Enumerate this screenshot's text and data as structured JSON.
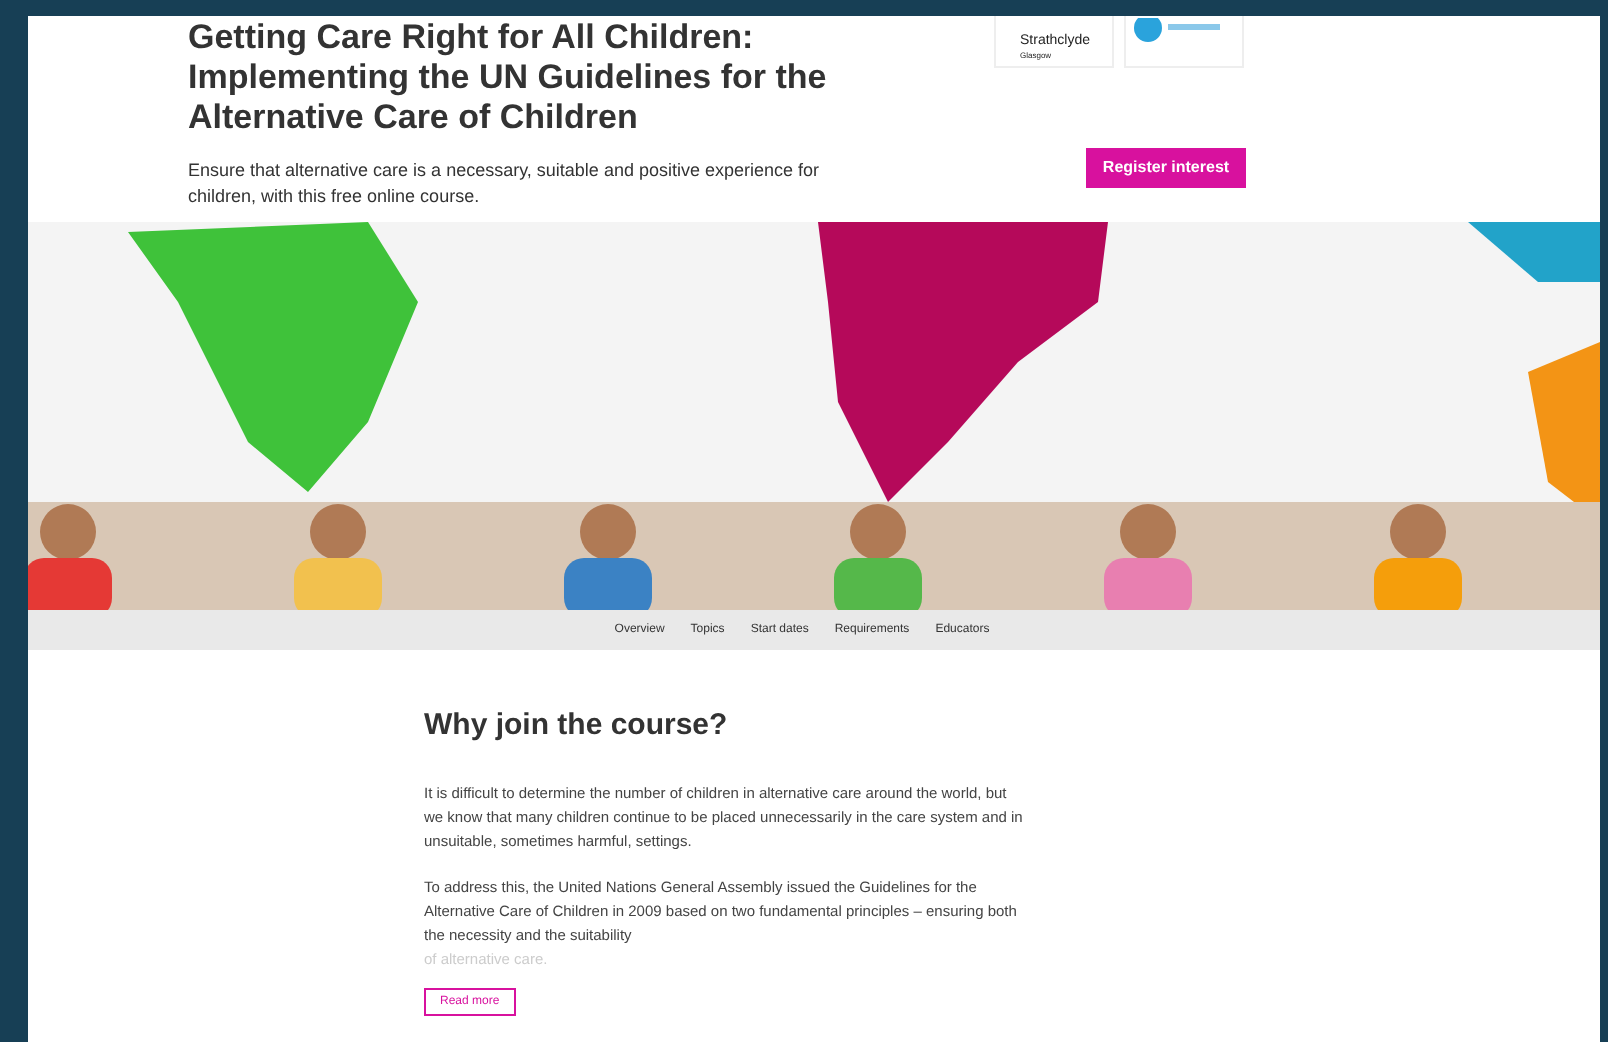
{
  "header": {
    "title": "Getting Care Right for All Children: Implementing the UN Guidelines for the Alternative Care of Children",
    "description": "Ensure that alternative care is a necessary, suitable and positive experience for children, with this free online course.",
    "logos": [
      {
        "kind": "text",
        "lines": [
          "Strathclyde",
          "Glasgow"
        ]
      },
      {
        "kind": "badge"
      }
    ],
    "register_button": "Register interest"
  },
  "nav": [
    {
      "label": "Overview"
    },
    {
      "label": "Topics"
    },
    {
      "label": "Start dates"
    },
    {
      "label": "Requirements"
    },
    {
      "label": "Educators"
    }
  ],
  "section": {
    "heading": "Why join the course?",
    "paragraphs": [
      {
        "text": "It is difficult to determine the number of children in alternative care around the world, but we know that many children continue to be placed unnecessarily in the care system and in unsuitable, sometimes harmful, settings.",
        "faded": false
      },
      {
        "text": "To address this, the United Nations General Assembly issued the Guidelines for the Alternative Care of Children in 2009 based on two fundamental principles – ensuring both the necessity and the suitability",
        "faded": false
      },
      {
        "text": "of alternative care.",
        "faded": true
      }
    ],
    "read_more": "Read more"
  }
}
